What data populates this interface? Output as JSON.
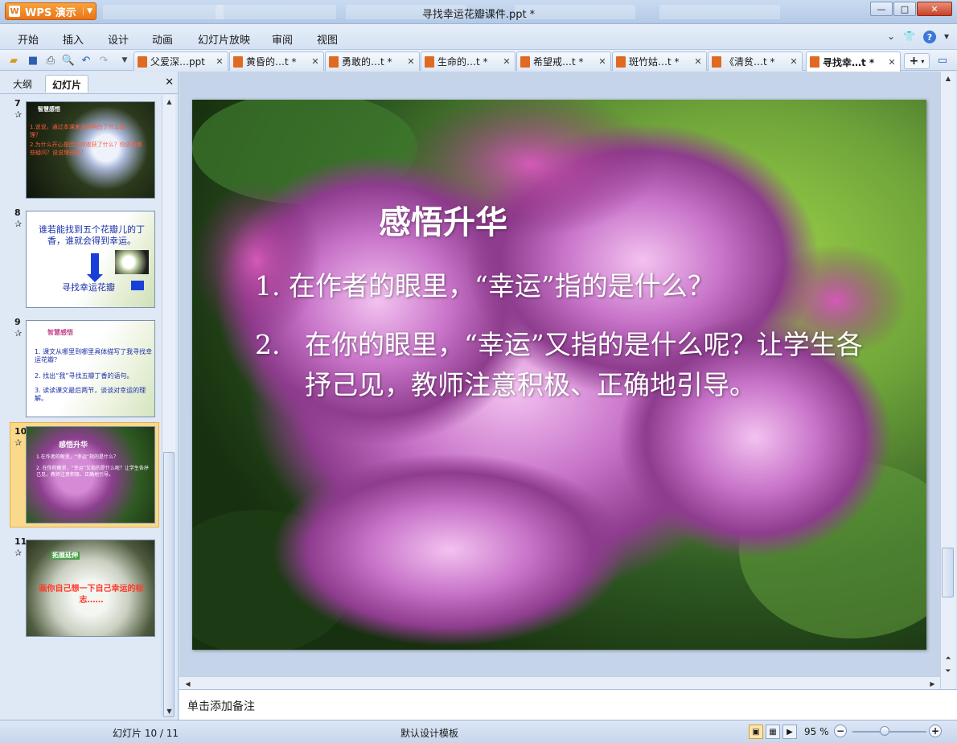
{
  "window": {
    "app_button": "WPS 演示",
    "title": "寻找幸运花瓣课件.ppt *",
    "controls": {
      "minimize": "—",
      "maximize": "□",
      "close": "✕"
    }
  },
  "menu": {
    "items": [
      "开始",
      "插入",
      "设计",
      "动画",
      "幻灯片放映",
      "审阅",
      "视图"
    ]
  },
  "doc_tabs": [
    {
      "label": "父爱深…ppt",
      "active": false
    },
    {
      "label": "黄昏的…t *",
      "active": false
    },
    {
      "label": "勇敢的…t *",
      "active": false
    },
    {
      "label": "生命的…t *",
      "active": false
    },
    {
      "label": "希望戒…t *",
      "active": false
    },
    {
      "label": "斑竹姑…t *",
      "active": false
    },
    {
      "label": "《清贫…t *",
      "active": false
    },
    {
      "label": "寻找幸…t *",
      "active": true
    }
  ],
  "left_panel": {
    "tabs": [
      "大纲",
      "幻灯片"
    ],
    "active_tab": "幻灯片",
    "slides": [
      {
        "num": "7",
        "title": "智慧感悟",
        "lines": [
          "1.说说，通过本课来说你明白了什么道理？",
          "2.为什么开心是因为你收获了什么？你还有哪些疑问？说说理由呢？"
        ]
      },
      {
        "num": "8",
        "lines": [
          "谁若能找到五个花瓣儿的丁香，谁就会得到幸运。",
          "寻找幸运花瓣"
        ]
      },
      {
        "num": "9",
        "title": "智慧感悟",
        "lines": [
          "1. 课文从哪里到哪里具体描写了我寻找幸运花瓣？",
          "2. 找出“我”寻找五瓣丁香的语句。",
          "3. 读读课文最后两节，谈谈对幸运的理解。"
        ]
      },
      {
        "num": "10",
        "title": "感悟升华",
        "lines": [
          "1.在作者的眼里，“幸运”指的是什么？",
          "2. 在你的眼里，“幸运”又指的是什么呢？让学生各抒己见，教师注意积极、正确地引导。"
        ]
      },
      {
        "num": "11",
        "title": "拓展延伸",
        "lines": [
          "画你自己想一下自己幸运的标志……"
        ]
      }
    ]
  },
  "slide": {
    "title": "感悟升华",
    "point1": "1. 在作者的眼里，“幸运”指的是什么？",
    "point2_num": "2.",
    "point2_text": "在你的眼里，“幸运”又指的是什么呢？让学生各抒己见，教师注意积极、正确地引导。"
  },
  "notes_placeholder": "单击添加备注",
  "status": {
    "slide_counter": "幻灯片 10 / 11",
    "template": "默认设计模板",
    "zoom": "95 %"
  },
  "colors": {
    "accent": "#3b78d8",
    "wps_orange": "#e8751a",
    "selected_thumb": "#fbd98a"
  }
}
